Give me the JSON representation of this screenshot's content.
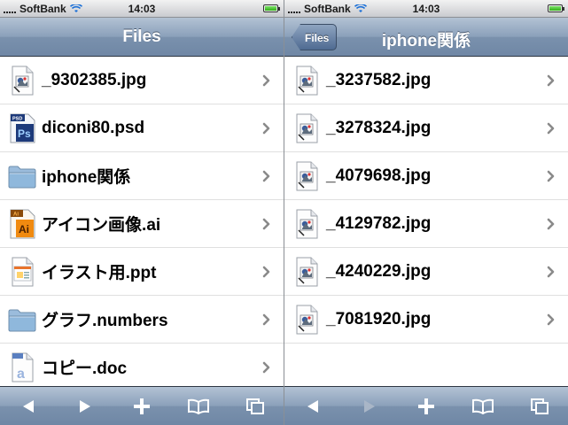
{
  "status_bar": {
    "carrier": "SoftBank",
    "time": "14:03",
    "battery_level": 1.0
  },
  "left_panel": {
    "nav": {
      "title": "Files"
    },
    "items": [
      {
        "label": "_9302385.jpg",
        "icon": "image-file-icon"
      },
      {
        "label": "diconi80.psd",
        "icon": "photoshop-file-icon"
      },
      {
        "label": "iphone関係",
        "icon": "folder-icon"
      },
      {
        "label": "アイコン画像.ai",
        "icon": "illustrator-file-icon"
      },
      {
        "label": "イラスト用.ppt",
        "icon": "powerpoint-file-icon"
      },
      {
        "label": "グラフ.numbers",
        "icon": "folder-icon"
      },
      {
        "label": "コピー.doc",
        "icon": "word-file-icon"
      }
    ],
    "toolbar": [
      "back-arrow-icon",
      "forward-arrow-icon",
      "add-icon",
      "bookmarks-icon",
      "pages-icon"
    ]
  },
  "right_panel": {
    "nav": {
      "back_label": "Files",
      "title": "iphone関係"
    },
    "items": [
      {
        "label": "_3237582.jpg",
        "icon": "image-file-icon"
      },
      {
        "label": "_3278324.jpg",
        "icon": "image-file-icon"
      },
      {
        "label": "_4079698.jpg",
        "icon": "image-file-icon"
      },
      {
        "label": "_4129782.jpg",
        "icon": "image-file-icon"
      },
      {
        "label": "_4240229.jpg",
        "icon": "image-file-icon"
      },
      {
        "label": "_7081920.jpg",
        "icon": "image-file-icon"
      }
    ],
    "toolbar": [
      "back-arrow-icon",
      "forward-arrow-icon-disabled",
      "add-icon",
      "bookmarks-icon",
      "pages-icon"
    ]
  },
  "colors": {
    "nav_bar": "#7a91ad",
    "status_bar": "#c9cbcf",
    "chevron": "#8a8a8a",
    "battery": "#2fae16",
    "wifi": "#1b6fd6",
    "folder": "#8fb8dc",
    "photoshop": "#1d3a7a",
    "illustrator": "#f08a10",
    "powerpoint": "#e8732a"
  }
}
